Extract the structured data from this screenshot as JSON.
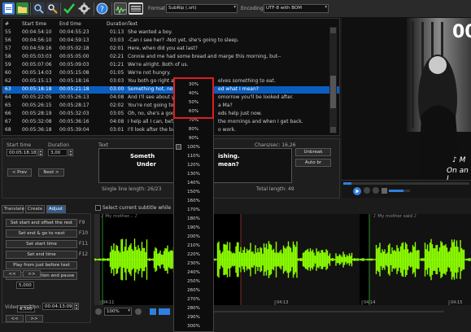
{
  "toolbar": {
    "format_label": "Format",
    "format_value": "SubRip (.srt)",
    "encoding_label": "Encoding",
    "encoding_value": "UTF-8 with BOM",
    "icons": [
      "new-file-icon",
      "open-file-icon",
      "save-icon",
      "save-as-icon",
      "find-icon",
      "replace-icon",
      "spell-check-icon",
      "settings-icon",
      "help-icon",
      "waveform-toggle-icon",
      "video-toggle-icon"
    ]
  },
  "grid": {
    "headers": {
      "num": "#",
      "start": "Start time",
      "end": "End time",
      "duration": "Duration",
      "text": "Text"
    },
    "rows": [
      {
        "num": "55",
        "start": "00:04:54:10",
        "end": "00:04:55:23",
        "duration": "01:13",
        "text": "She wanted a boy."
      },
      {
        "num": "56",
        "start": "00:04:56:10",
        "end": "00:04:59:13",
        "duration": "03:03",
        "text": "-Can I see her? -Not yet, she's going to sleep."
      },
      {
        "num": "57",
        "start": "00:04:59:16",
        "end": "00:05:02:18",
        "duration": "02:01",
        "text": "Here, when did you eat last?"
      },
      {
        "num": "58",
        "start": "00:05:03:03",
        "end": "00:05:05:00",
        "duration": "02:21",
        "text": "Connie and me had some bread and marge this morning, but--"
      },
      {
        "num": "59",
        "start": "00:05:07:06",
        "end": "00:05:09:03",
        "duration": "01:21",
        "text": "We're alright. Both of us."
      },
      {
        "num": "60",
        "start": "00:05:14:03",
        "end": "00:05:15:08",
        "duration": "01:05",
        "text": "We're not hungry."
      },
      {
        "num": "62",
        "start": "00:05:15:13",
        "end": "00:05:18:16",
        "duration": "03:03",
        "text": "You both go right a..."
      },
      {
        "num": "63",
        "start": "00:05:18:18",
        "end": "00:05:21:18",
        "duration": "03:00",
        "text": "Something hot, now..."
      },
      {
        "num": "64",
        "start": "00:05:22:05",
        "end": "00:05:26:13",
        "duration": "04:08",
        "text": "And I'll see about y..."
      },
      {
        "num": "65",
        "start": "00:05:26:15",
        "end": "00:05:28:17",
        "duration": "02:02",
        "text": "You're not going to..."
      },
      {
        "num": "66",
        "start": "00:05:28:19",
        "end": "00:05:32:03",
        "duration": "03:05",
        "text": "Oh, no, she's a goo..."
      },
      {
        "num": "67",
        "start": "00:05:32:08",
        "end": "00:05:36:16",
        "duration": "04:08",
        "text": "I help all I can, bef..."
      },
      {
        "num": "68",
        "start": "00:05:36:18",
        "end": "00:05:39:04",
        "duration": "03:01",
        "text": "I'll look after the ba..."
      }
    ],
    "row_tails": [
      {
        "row": 6,
        "text": "elves something to eat."
      },
      {
        "row": 7,
        "text": "ed what I mean?"
      },
      {
        "row": 8,
        "text": "omorrow you'll be looked after."
      },
      {
        "row": 9,
        "text": "a Ma?"
      },
      {
        "row": 10,
        "text": "eds help just now."
      },
      {
        "row": 11,
        "text": "the mornings and when I get back."
      },
      {
        "row": 12,
        "text": "o work."
      }
    ]
  },
  "editor": {
    "start_label": "Start time",
    "start_value": "00:05:18:18",
    "duration_label": "Duration",
    "duration_value": "3,00",
    "text_label": "Text",
    "text_line1_left": "Someth",
    "text_line1_right": "ishing.",
    "text_line2_left": "Under",
    "text_line2_right": "mean?",
    "chars_sec": "Chars/sec: 16,26",
    "unbreak": "Unbreak",
    "auto_br": "Auto br",
    "prev": "< Prev",
    "next": "Next >",
    "single_line": "Single line length: 26/23",
    "total_length": "Total length: 49"
  },
  "video": {
    "subtitle_line1": "♪ M",
    "subtitle_line2": "On an I"
  },
  "tabs": [
    "Translate",
    "Create",
    "Adjust"
  ],
  "select_current": "Select current subtitle while playing",
  "adjust": {
    "buttons": [
      {
        "label": "Set start and offset the rest",
        "key": "F9"
      },
      {
        "label": "Set end & go to next",
        "key": "F10"
      },
      {
        "label": "Set start time",
        "key": "F11"
      },
      {
        "label": "Set end time",
        "key": "F12"
      },
      {
        "label": "Play from just before text",
        "key": ""
      },
      {
        "label": "Go to sub position and pause",
        "key": ""
      }
    ],
    "step1_value": "0,500",
    "step2_value": "5,000",
    "back_label": "<<",
    "fwd_label": ">>",
    "video_position_label": "Video position:",
    "video_position_value": "00:04:13:09"
  },
  "waveform": {
    "labels_top": [
      {
        "text": "♪ My mother... ♪"
      },
      {
        "text": "♪ My mother said ♪"
      }
    ],
    "time_ticks": [
      "04:11",
      "04:12",
      "04:13",
      "04:14",
      "04:15"
    ],
    "zoom_value": "100%",
    "bar_color": "#8dff00"
  },
  "zoom_menu": {
    "items": [
      "30%",
      "40%",
      "50%",
      "60%",
      "70%",
      "80%",
      "90%",
      "100%",
      "110%",
      "120%",
      "130%",
      "140%",
      "150%",
      "160%",
      "170%",
      "180%",
      "190%",
      "200%",
      "210%",
      "220%",
      "230%",
      "240%",
      "250%",
      "260%",
      "270%",
      "280%",
      "290%",
      "300%"
    ],
    "highlighted_count": 4,
    "checked_item": "100%"
  }
}
